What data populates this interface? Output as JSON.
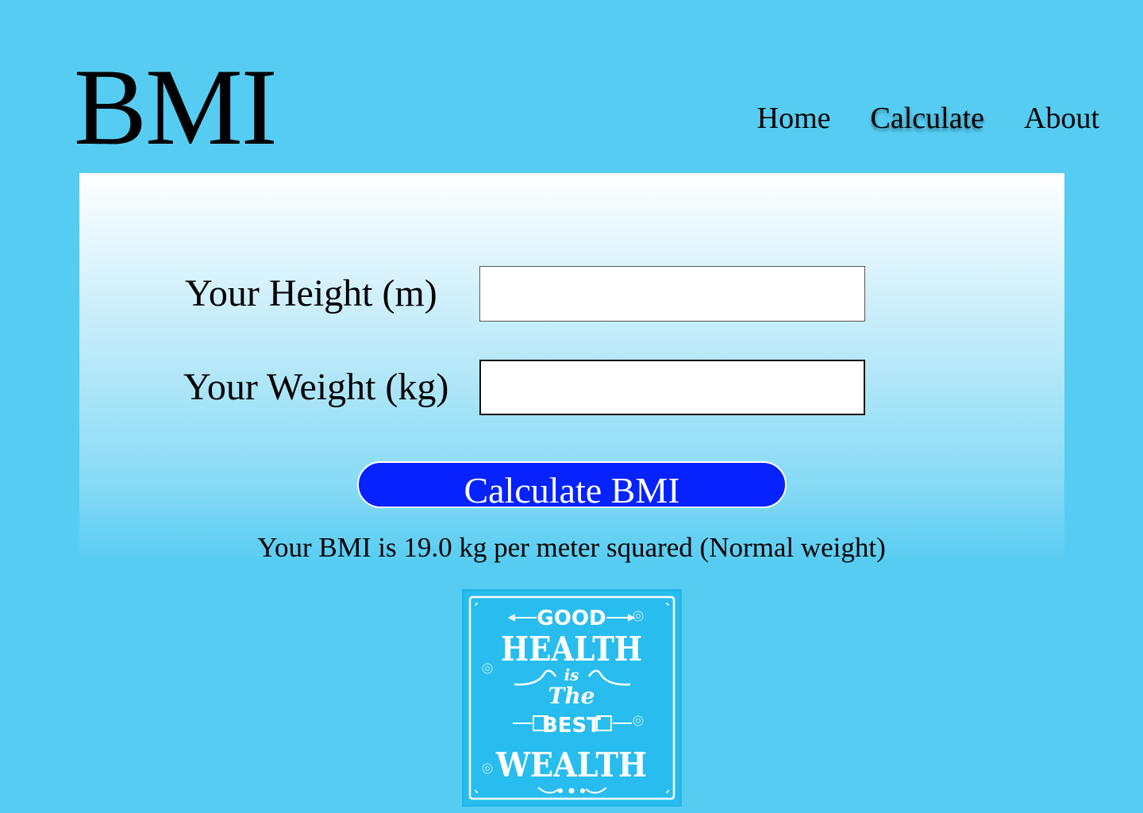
{
  "header": {
    "logo": "BMI",
    "nav": [
      {
        "label": "Home",
        "active": false
      },
      {
        "label": "Calculate",
        "active": true
      },
      {
        "label": "About",
        "active": false
      }
    ]
  },
  "form": {
    "height_label": "Your Height (m)",
    "height_value": "",
    "weight_label": "Your Weight (kg)",
    "weight_value": "",
    "button_label": "Calculate BMI"
  },
  "result": {
    "text": "Your BMI is 19.0 kg per meter squared (Normal weight)"
  },
  "poster": {
    "line1": "GOOD",
    "line2": "HEALTH",
    "line3": "is",
    "line4": "The",
    "line5": "BEST",
    "line6": "WEALTH"
  },
  "colors": {
    "background": "#56ccf2",
    "button": "#0622ff",
    "poster": "#21b6e9"
  }
}
